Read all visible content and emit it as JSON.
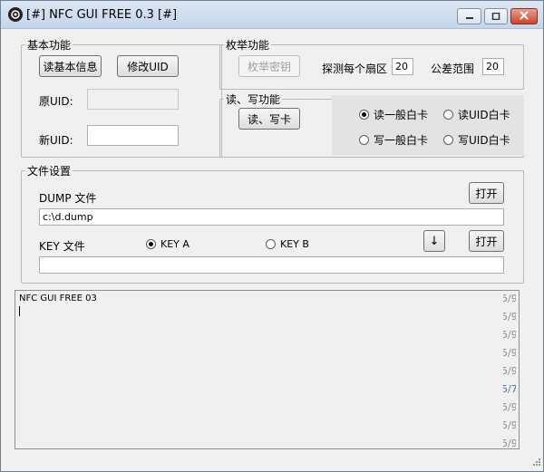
{
  "window": {
    "title": "[#] NFC GUI FREE 0.3 [#]"
  },
  "basic": {
    "legend": "基本功能",
    "read_info_button": "读基本信息",
    "modify_uid_button": "修改UID",
    "orig_uid_label": "原UID:",
    "orig_uid_value": "",
    "new_uid_label": "新UID:",
    "new_uid_value": ""
  },
  "enum": {
    "legend": "枚举功能",
    "enum_key_button": "枚举密钥",
    "probe_label": "探测每个扇区",
    "probe_value": "20",
    "tolerance_label": "公差范围",
    "tolerance_value": "20"
  },
  "rw": {
    "legend": "读、写功能",
    "rw_button": "读、写卡",
    "options": [
      {
        "label": "读一般白卡",
        "checked": true
      },
      {
        "label": "读UID白卡",
        "checked": false
      },
      {
        "label": "写一般白卡",
        "checked": false
      },
      {
        "label": "写UID白卡",
        "checked": false
      }
    ]
  },
  "files": {
    "legend": "文件设置",
    "dump_label": "DUMP 文件",
    "dump_open": "打开",
    "dump_path": "c:\\d.dump",
    "key_label": "KEY 文件",
    "key_a_label": "KEY A",
    "key_a_checked": true,
    "key_b_label": "KEY B",
    "key_b_checked": false,
    "arrow_button": "↓",
    "key_open": "打开",
    "key_path": ""
  },
  "log": {
    "first_line": "NFC GUI FREE 03",
    "gutter_rows": [
      "5/9/",
      "5/9/",
      "5/9/",
      "5/9/",
      "5/9/",
      "5/7/",
      "5/9/",
      "5/9/",
      "5/9/"
    ]
  }
}
